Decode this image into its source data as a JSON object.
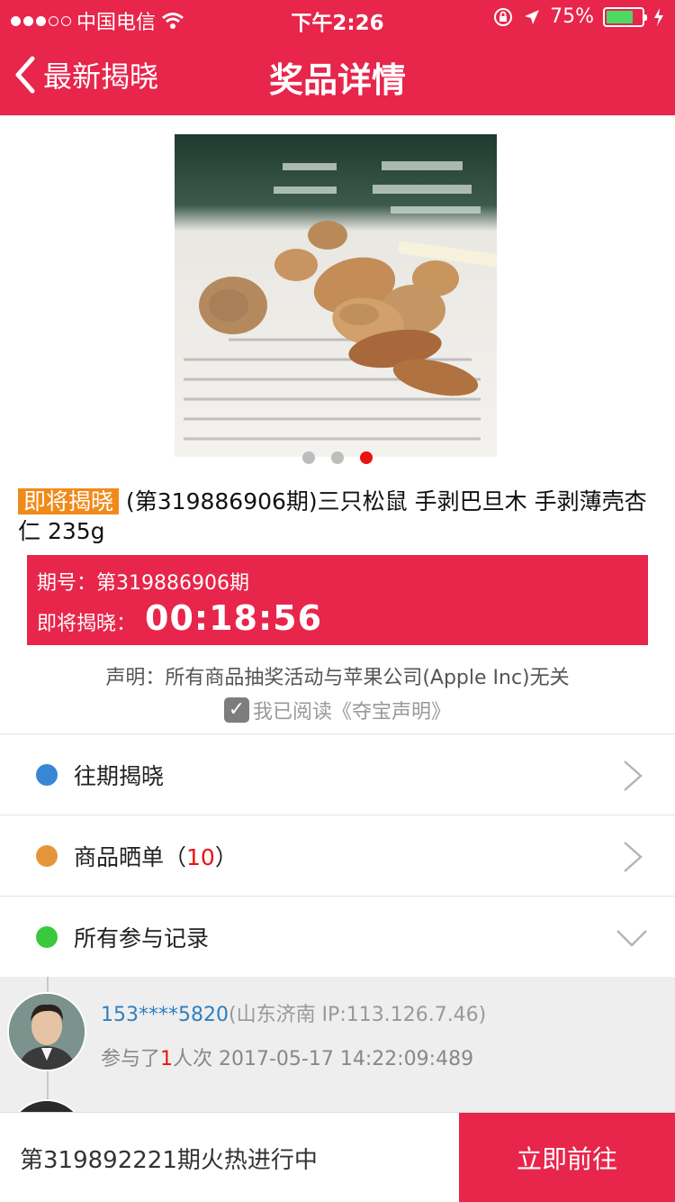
{
  "status_bar": {
    "carrier": "中国电信",
    "time": "下午2:26",
    "battery_percent": "75%",
    "battery_level": 0.75,
    "signal_bars_filled": 3,
    "signal_bars_total": 5
  },
  "nav": {
    "back_label": "最新揭晓",
    "title": "奖品详情"
  },
  "carousel": {
    "slide_count": 3,
    "active_index": 2
  },
  "product": {
    "tag": "即将揭晓",
    "title": "(第319886906期)三只松鼠 手剥巴旦木 手剥薄壳杏仁 235g"
  },
  "countdown_box": {
    "issue_label": "期号：",
    "issue_value": "第319886906期",
    "countdown_label": "即将揭晓：",
    "countdown_value": "00:18:56"
  },
  "disclaimer": "声明：所有商品抽奖活动与苹果公司(Apple Inc)无关",
  "agreement": {
    "text": "我已阅读《夺宝声明》",
    "checked": true
  },
  "menu": {
    "past": {
      "label": "往期揭晓",
      "color": "#3a86d6"
    },
    "share": {
      "label": "商品晒单（",
      "count": "10",
      "suffix": "）",
      "color": "#e6963a"
    },
    "records": {
      "label": "所有参与记录",
      "color": "#3cc83c"
    }
  },
  "records": [
    {
      "user": "153****5820",
      "location": "(山东济南 IP:113.126.7.46)",
      "info_prefix": "参与了",
      "times": "1",
      "info_suffix": "人次 2017-05-17 14:22:09:489"
    }
  ],
  "bottom_bar": {
    "next_issue": "第319892221期火热进行中",
    "go_button": "立即前往"
  },
  "colors": {
    "brand_red": "#e8254b",
    "tag_orange": "#f08a1a",
    "highlight_red": "#e8140e",
    "link_blue": "#2e7fc2"
  }
}
